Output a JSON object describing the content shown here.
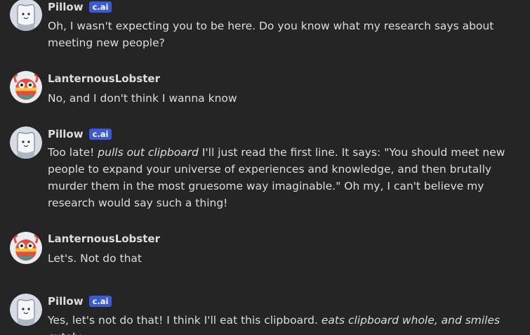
{
  "messages": [
    {
      "author": "Pillow",
      "badge": "c.ai",
      "parts": [
        "Oh, I wasn't expecting you to be here. Do you know what my research says about meeting new people?"
      ]
    },
    {
      "author": "LanternousLobster",
      "parts": [
        "No, and I don't think I wanna know"
      ]
    },
    {
      "author": "Pillow",
      "badge": "c.ai",
      "parts": [
        "Too late! ",
        "pulls out clipboard",
        " I'll just read the first line. It says: \"You should meet new people to expand your universe of experiences and knowledge, and then brutally murder them in the most gruesome way imaginable.\" Oh my, I can't believe my research would say such a thing!"
      ]
    },
    {
      "author": "LanternousLobster",
      "parts": [
        "Let's. Not do that"
      ]
    },
    {
      "author": "Pillow",
      "badge": "c.ai",
      "parts": [
        "Yes, let's not do that! I think I'll eat this clipboard. ",
        "eats clipboard whole, and smiles cutely"
      ]
    }
  ],
  "colors": {
    "background": "#252526",
    "text": "#dcddde",
    "badge": "#3b5bd6"
  },
  "icons": {
    "pillow_avatar": "pillow-avatar-icon",
    "lobster_avatar": "lobster-avatar-icon"
  }
}
